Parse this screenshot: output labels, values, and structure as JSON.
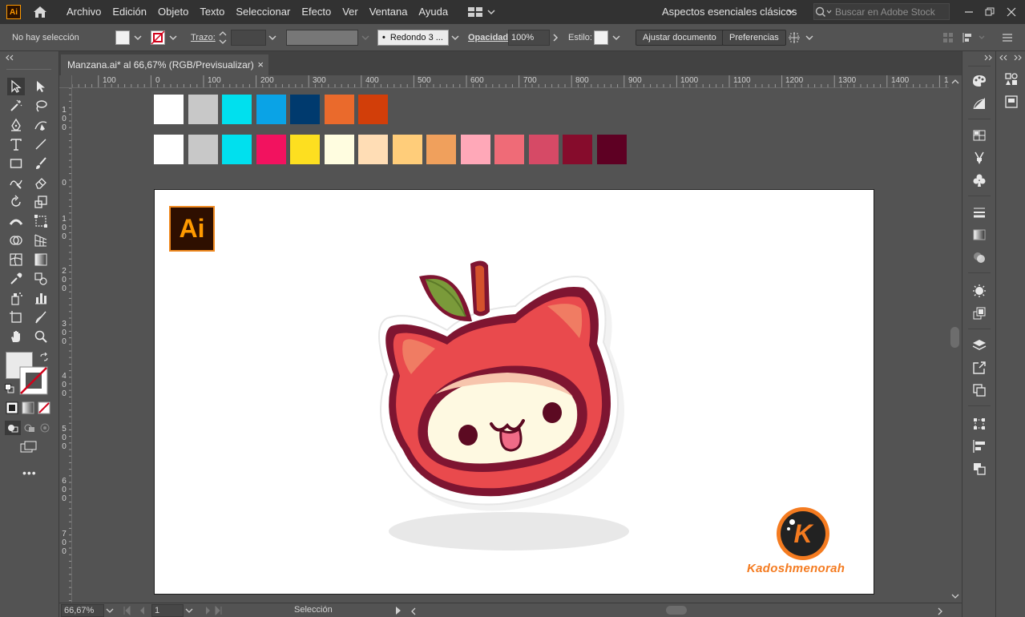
{
  "app": {
    "logo_text": "Ai"
  },
  "menu": {
    "items": [
      "Archivo",
      "Edición",
      "Objeto",
      "Texto",
      "Seleccionar",
      "Efecto",
      "Ver",
      "Ventana",
      "Ayuda"
    ]
  },
  "workspace": {
    "label": "Aspectos esenciales clásicos"
  },
  "search": {
    "placeholder": "Buscar en Adobe Stock"
  },
  "control": {
    "selection_status": "No hay selección",
    "stroke_label": "Trazo:",
    "brush_label": "Redondo 3 ...",
    "opacity_label": "Opacidad:",
    "opacity_value": "100%",
    "style_label": "Estilo:",
    "fit_button": "Ajustar documento",
    "prefs_button": "Preferencias"
  },
  "document": {
    "tab_title": "Manzana.ai* al 66,67% (RGB/Previsualizar)",
    "close_glyph": "×"
  },
  "rulers": {
    "top": [
      "100",
      "0",
      "100",
      "200",
      "300",
      "400",
      "500",
      "600",
      "700",
      "800",
      "900",
      "1000",
      "1100",
      "1200",
      "1300",
      "1400",
      "1"
    ],
    "left": [
      "1\n0\n0",
      "0",
      "1\n0\n0",
      "2\n0\n0",
      "3\n0\n0",
      "4\n0\n0",
      "5\n0\n0",
      "6\n0\n0",
      "7\n0\n0"
    ]
  },
  "swatches": {
    "row1": [
      "#ffffff",
      "#c8c8c8",
      "#00e0ee",
      "#0aa3e6",
      "#003a6e",
      "#ea6a2c",
      "#d23e09"
    ],
    "row2": [
      "#ffffff",
      "#c8c8c8",
      "#00e0ee",
      "#f2125f",
      "#fddf20",
      "#fffde0",
      "#ffddb5",
      "#ffcd7a",
      "#f0a05c",
      "#ffa8b8",
      "#ef6b77",
      "#d64a66",
      "#860c2c",
      "#5e0023"
    ]
  },
  "artwork": {
    "ai_badge": "Ai",
    "brand_letter": "K",
    "brand_name": "Kadoshmenorah",
    "colors": {
      "apple": "#e94a4d",
      "outline": "#7e1531",
      "cream": "#fef9e1",
      "leaf": "#7a9a3a",
      "stem": "#d4522c",
      "brand": "#f47b20"
    }
  },
  "status": {
    "zoom": "66,67%",
    "artboard_number": "1",
    "tool_name": "Selección"
  }
}
